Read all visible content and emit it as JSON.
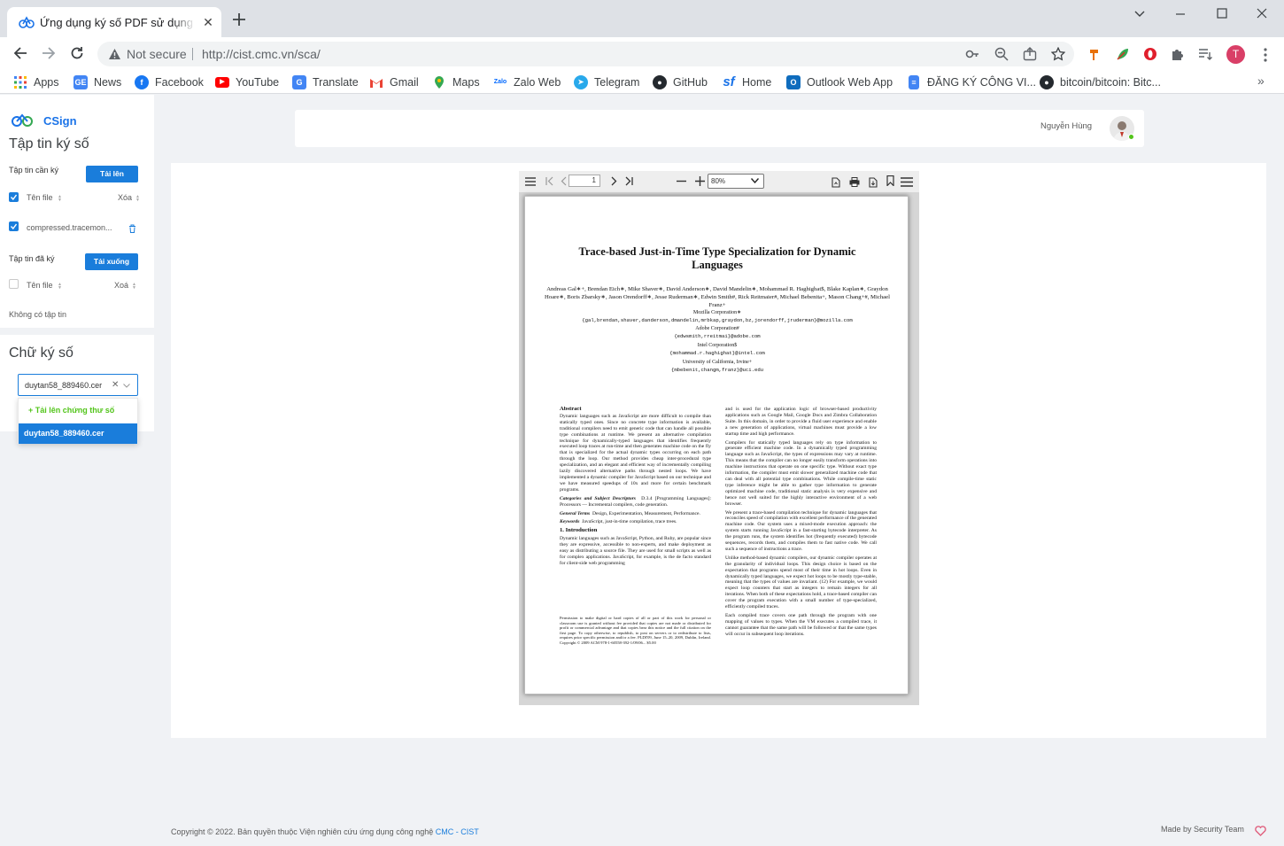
{
  "browser": {
    "tab_title": "Ứng dụng ký số PDF sử dụng dịch vụ chữ ký số",
    "not_secure": "Not secure",
    "url": "http://cist.cmc.vn/sca/",
    "profile_initial": "T"
  },
  "bookmarks": [
    {
      "label": "Apps",
      "icon": "apps-grid-icon"
    },
    {
      "label": "News",
      "icon": "google-news-icon"
    },
    {
      "label": "Facebook",
      "icon": "facebook-icon"
    },
    {
      "label": "YouTube",
      "icon": "youtube-icon"
    },
    {
      "label": "Translate",
      "icon": "translate-icon"
    },
    {
      "label": "Gmail",
      "icon": "gmail-icon"
    },
    {
      "label": "Maps",
      "icon": "maps-icon"
    },
    {
      "label": "Zalo Web",
      "icon": "zalo-icon"
    },
    {
      "label": "Telegram",
      "icon": "telegram-icon"
    },
    {
      "label": "GitHub",
      "icon": "github-icon"
    },
    {
      "label": "Home",
      "icon": "sourceforge-icon"
    },
    {
      "label": "Outlook Web App",
      "icon": "outlook-icon"
    },
    {
      "label": "ĐĂNG KÝ CÔNG VI...",
      "icon": "docs-icon"
    },
    {
      "label": "bitcoin/bitcoin: Bitc...",
      "icon": "github-icon"
    }
  ],
  "sidebar": {
    "brand": "CSign",
    "files_title": "Tập tin ký số",
    "to_sign_label": "Tập tin cần ký",
    "upload_button": "Tải lên",
    "col_filename": "Tên file",
    "col_delete": "Xóa",
    "to_sign_file": "compressed.tracemon...",
    "signed_label": "Tập tin đã ký",
    "download_button": "Tải xuống",
    "signed_col_filename": "Tên file",
    "signed_col_delete": "Xoá",
    "empty_text": "Không có tập tin",
    "signature_title": "Chữ ký số",
    "cert_selected": "duytan58_889460.cer",
    "cert_upload": "+ Tải lên chứng thư số",
    "cert_options": [
      "duytan58_889460.cer"
    ]
  },
  "header": {
    "username": "Nguyễn Hùng"
  },
  "viewer": {
    "page_number": "1",
    "zoom": "80%"
  },
  "pdf": {
    "title": "Trace-based Just-in-Time Type Specialization for Dynamic Languages",
    "authors": "Andreas Gal∗+, Brendan Eich∗, Mike Shaver∗, David Anderson∗, David Mandelin∗, Mohammad R. Haghighat$, Blake Kaplan∗, Graydon Hoare∗, Boris Zbarsky∗, Jason Orendorff∗, Jesse Ruderman∗, Edwin Smith#, Rick Reitmaier#, Michael Bebenita+, Mason Chang+#, Michael Franz+",
    "aff1_name": "Mozilla Corporation∗",
    "aff1_email": "{gal,brendan,shaver,danderson,dmandelin,mrbkap,graydon,bz,jorendorff,jruderman}@mozilla.com",
    "aff2_name": "Adobe Corporation#",
    "aff2_email": "{edwsmith,rreitmai}@adobe.com",
    "aff3_name": "Intel Corporation$",
    "aff3_email": "{mohammad.r.haghighat}@intel.com",
    "aff4_name": "University of California, Irvine+",
    "aff4_email": "{mbebenit,changm,franz}@uci.edu",
    "abstract_heading": "Abstract",
    "abstract": "Dynamic languages such as JavaScript are more difficult to compile than statically typed ones. Since no concrete type information is available, traditional compilers need to emit generic code that can handle all possible type combinations at runtime. We present an alternative compilation technique for dynamically-typed languages that identifies frequently executed loop traces at run-time and then generates machine code on the fly that is specialized for the actual dynamic types occurring on each path through the loop. Our method provides cheap inter-procedural type specialization, and an elegant and efficient way of incrementally compiling lazily discovered alternative paths through nested loops. We have implemented a dynamic compiler for JavaScript based on our technique and we have measured speedups of 10x and more for certain benchmark programs.",
    "categories_label": "Categories and Subject Descriptors",
    "categories": "D.3.4 [Programming Languages]: Processors — Incremental compilers, code generation.",
    "terms_label": "General Terms",
    "terms": "Design, Experimentation, Measurement, Performance.",
    "keywords_label": "Keywords",
    "keywords": "JavaScript, just-in-time compilation, trace trees.",
    "intro_heading": "1.  Introduction",
    "intro": "Dynamic languages such as JavaScript, Python, and Ruby, are popular since they are expressive, accessible to non-experts, and make deployment as easy as distributing a source file. They are used for small scripts as well as for complex applications. JavaScript, for example, is the de facto standard for client-side web programming",
    "permission": "Permission to make digital or hard copies of all or part of this work for personal or classroom use is granted without fee provided that copies are not made or distributed for profit or commercial advantage and that copies bear this notice and the full citation on the first page. To copy otherwise, to republish, to post on servers or to redistribute to lists, requires prior specific permission and/or a fee. PLDI'09,   June 15–20, 2009, Dublin, Ireland. Copyright © 2009 ACM 978-1-60558-392-1/09/06... $5.00",
    "right_p1": "and is used for the application logic of browser-based productivity applications such as Google Mail, Google Docs and Zimbra Collaboration Suite. In this domain, in order to provide a fluid user experience and enable a new generation of applications, virtual machines must provide a low startup time and high performance.",
    "right_p2": "Compilers for statically typed languages rely on type information to generate efficient machine code. In a dynamically typed programming language such as JavaScript, the types of expressions may vary at runtime. This means that the compiler can no longer easily transform operations into machine instructions that operate on one specific type. Without exact type information, the compiler must emit slower generalized machine code that can deal with all potential type combinations. While compile-time static type inference might be able to gather type information to generate optimized machine code, traditional static analysis is very expensive and hence not well suited for the highly interactive environment of a web browser.",
    "right_p3": "We present a trace-based compilation technique for dynamic languages that reconciles speed of compilation with excellent performance of the generated machine code. Our system uses a mixed-mode execution approach: the system starts running JavaScript in a fast-starting bytecode interpreter. As the program runs, the system identifies hot (frequently executed) bytecode sequences, records them, and compiles them to fast native code. We call such a sequence of instructions a trace.",
    "right_p4": "Unlike method-based dynamic compilers, our dynamic compiler operates at the granularity of individual loops. This design choice is based on the expectation that programs spend most of their time in hot loops. Even in dynamically typed languages, we expect hot loops to be mostly type-stable, meaning that the types of values are invariant. (12) For example, we would expect loop counters that start as integers to remain integers for all iterations. When both of these expectations hold, a trace-based compiler can cover the program execution with a small number of type-specialized, efficiently compiled traces.",
    "right_p5": "Each compiled trace covers one path through the program with one mapping of values to types. When the VM executes a compiled trace, it cannot guarantee that the same path will be followed or that the same types will occur in subsequent loop iterations."
  },
  "footer": {
    "copyright": "Copyright © 2022. Bản quyền thuộc Viện nghiên cứu ứng dụng công nghệ",
    "org_link": "CMC - CIST",
    "made_by": "Made by Security Team"
  },
  "colors": {
    "accent": "#1a7ddb",
    "success": "#52c41a",
    "page_bg": "#f0f2f5"
  }
}
